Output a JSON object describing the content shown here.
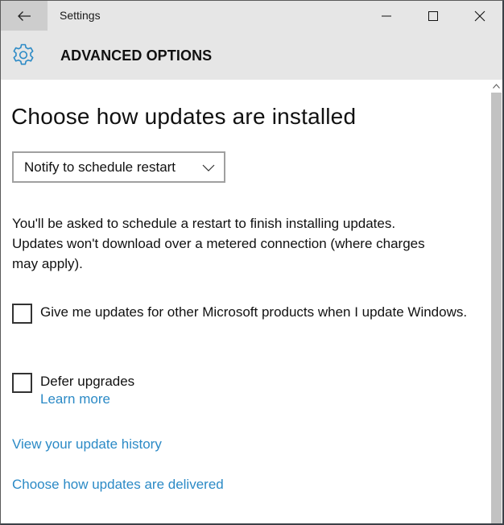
{
  "window": {
    "title": "Settings",
    "controls": {
      "back": "back-arrow-icon",
      "minimize": "minimize-icon",
      "maximize": "maximize-icon",
      "close": "close-icon"
    }
  },
  "header": {
    "icon": "gear-icon",
    "title": "ADVANCED OPTIONS"
  },
  "main": {
    "page_title": "Choose how updates are installed",
    "install_mode_dropdown": {
      "selected": "Notify to schedule restart"
    },
    "description_lines": [
      "You'll be asked to schedule a restart to finish installing updates.",
      "Updates won't download over a metered connection (where charges",
      "may apply)."
    ],
    "checkboxes": [
      {
        "label": "Give me updates for other Microsoft products when I update Windows.",
        "checked": false
      },
      {
        "label": "Defer upgrades",
        "checked": false,
        "link": "Learn more"
      }
    ],
    "links": {
      "history": "View your update history",
      "delivered": "Choose how updates are delivered"
    }
  },
  "colors": {
    "accent": "#2b8ac6",
    "titlebar_bg": "#e6e6e6",
    "back_button_bg": "#cdcdcd"
  }
}
